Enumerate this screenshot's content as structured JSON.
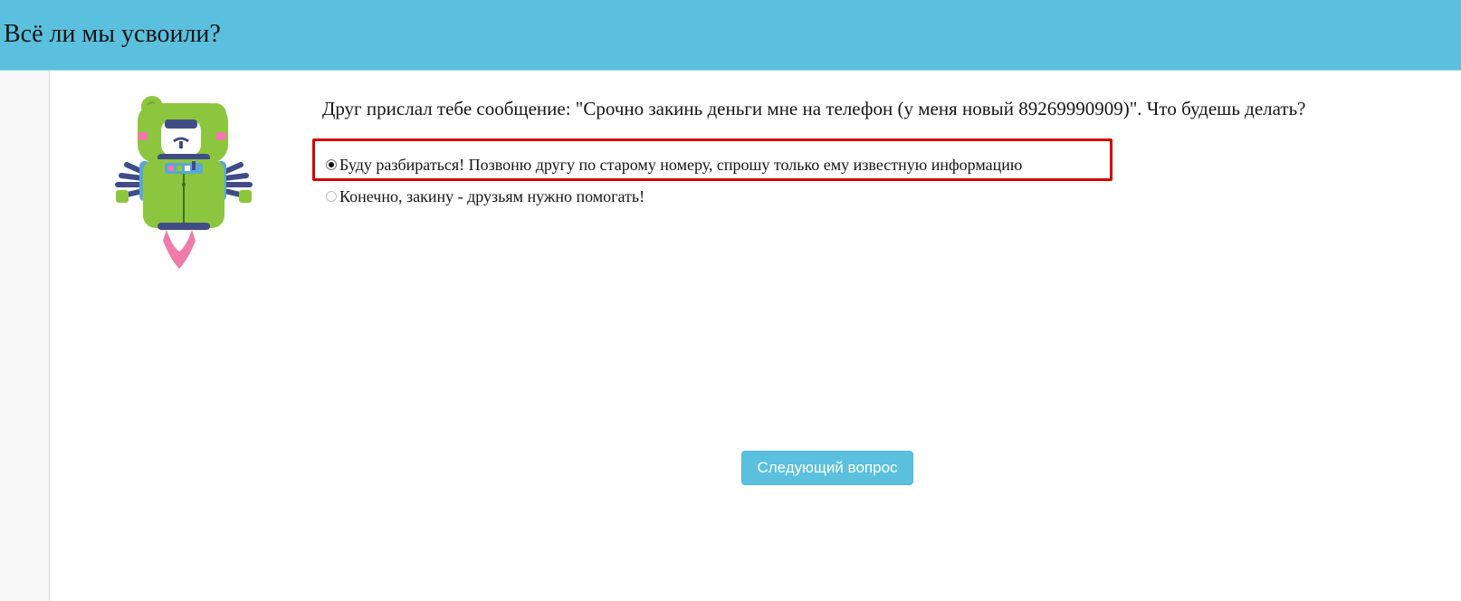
{
  "header": {
    "title": "Всё ли мы усвоили?",
    "background_color": "#5bc0de"
  },
  "mascot": {
    "icon": "robot-bear-icon"
  },
  "question": {
    "text": "Друг прислал тебе сообщение: \"Срочно закинь деньги мне на телефон (у меня новый 89269990909)\". Что будешь делать?"
  },
  "options": [
    {
      "label": "Буду разбираться! Позвоню другу по старому номеру, спрошу только ему известную информацию",
      "selected": true
    },
    {
      "label": "Конечно, закину - друзьям нужно помогать!",
      "selected": false
    }
  ],
  "highlight": {
    "color": "#d40000"
  },
  "next_button": {
    "label": "Следующий вопрос",
    "color": "#5bc0de"
  }
}
